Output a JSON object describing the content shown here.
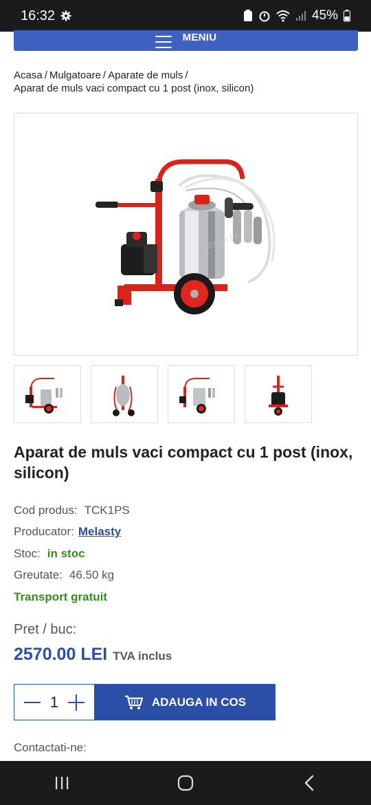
{
  "status": {
    "time": "16:32",
    "battery": "45%"
  },
  "menu": {
    "label": "MENIU"
  },
  "breadcrumb": {
    "items": [
      "Acasa",
      "Mulgatoare",
      "Aparate de muls"
    ],
    "current": "Aparat de muls vaci compact cu 1 post (inox, silicon)"
  },
  "product": {
    "title": "Aparat de muls vaci compact cu 1 post (inox, silicon)",
    "code_label": "Cod produs:",
    "code": "TCK1PS",
    "producer_label": "Producator:",
    "producer": "Melasty",
    "stock_label": "Stoc:",
    "stock": "in stoc",
    "weight_label": "Greutate:",
    "weight": "46.50 kg",
    "transport": "Transport gratuit",
    "price_label": "Pret / buc:",
    "price": "2570.00 LEI",
    "vat": "TVA inclus",
    "quantity": "1",
    "add_to_cart": "ADAUGA IN COS",
    "contact": "Contactati-ne:",
    "thumbnail_count": 4
  },
  "colors": {
    "accent_blue": "#2b4ea6",
    "menu_blue": "#3f61c2",
    "stock_green": "#3a8a22",
    "frame_red": "#e0261e"
  },
  "icons": {
    "settings": "gear-icon",
    "menu": "hamburger-icon",
    "cart": "cart-icon",
    "nav_recent": "recent-apps-icon",
    "nav_home": "home-icon",
    "nav_back": "back-icon"
  }
}
